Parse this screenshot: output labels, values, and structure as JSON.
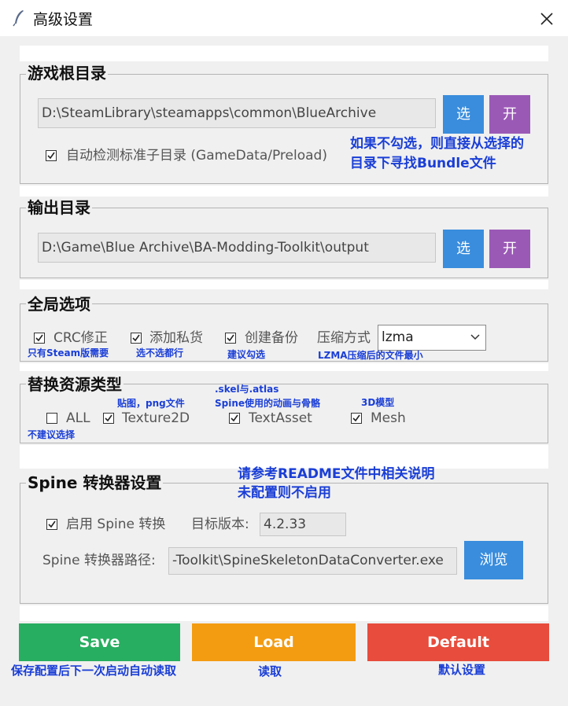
{
  "window": {
    "title": "高级设置"
  },
  "game_root": {
    "title": "游戏根目录",
    "path": "D:\\SteamLibrary\\steamapps\\common\\BlueArchive",
    "select_label": "选",
    "open_label": "开",
    "auto_detect_label": "自动检测标准子目录 (GameData/Preload)",
    "auto_detect_checked": true,
    "note_line1": "如果不勾选，则直接从选择的",
    "note_line2": "目录下寻找Bundle文件"
  },
  "output_dir": {
    "title": "输出目录",
    "path": "D:\\Game\\Blue Archive\\BA-Modding-Toolkit\\output",
    "select_label": "选",
    "open_label": "开"
  },
  "global_options": {
    "title": "全局选项",
    "crc_label": "CRC修正",
    "crc_checked": true,
    "crc_note": "只有Steam版需要",
    "private_label": "添加私货",
    "private_checked": true,
    "private_note": "选不选都行",
    "backup_label": "创建备份",
    "backup_checked": true,
    "backup_note": "建议勾选",
    "compression_label": "压缩方式",
    "compression_value": "lzma",
    "compression_note": "LZMA压缩后的文件最小"
  },
  "replace_types": {
    "title": "替换资源类型",
    "all_label": "ALL",
    "all_checked": false,
    "all_note": "不建议选择",
    "texture_label": "Texture2D",
    "texture_checked": true,
    "texture_note": "贴图，png文件",
    "textasset_label": "TextAsset",
    "textasset_checked": true,
    "textasset_note1": ".skel与.atlas",
    "textasset_note2": "Spine使用的动画与骨骼",
    "mesh_label": "Mesh",
    "mesh_checked": true,
    "mesh_note": "3D模型"
  },
  "spine": {
    "title": "Spine 转换器设置",
    "note_line1": "请参考README文件中相关说明",
    "note_line2": "未配置则不启用",
    "enable_label": "启用 Spine 转换",
    "enable_checked": true,
    "version_label": "目标版本:",
    "version_value": "4.2.33",
    "path_label": "Spine 转换器路径:",
    "path_value": "-Toolkit\\SpineSkeletonDataConverter.exe",
    "browse_label": "浏览"
  },
  "actions": {
    "save_label": "Save",
    "save_note": "保存配置后下一次启动自动读取",
    "load_label": "Load",
    "load_note": "读取",
    "default_label": "Default",
    "default_note": "默认设置",
    "save_color": "#27ae60",
    "load_color": "#f39c12",
    "default_color": "#e74c3c"
  }
}
